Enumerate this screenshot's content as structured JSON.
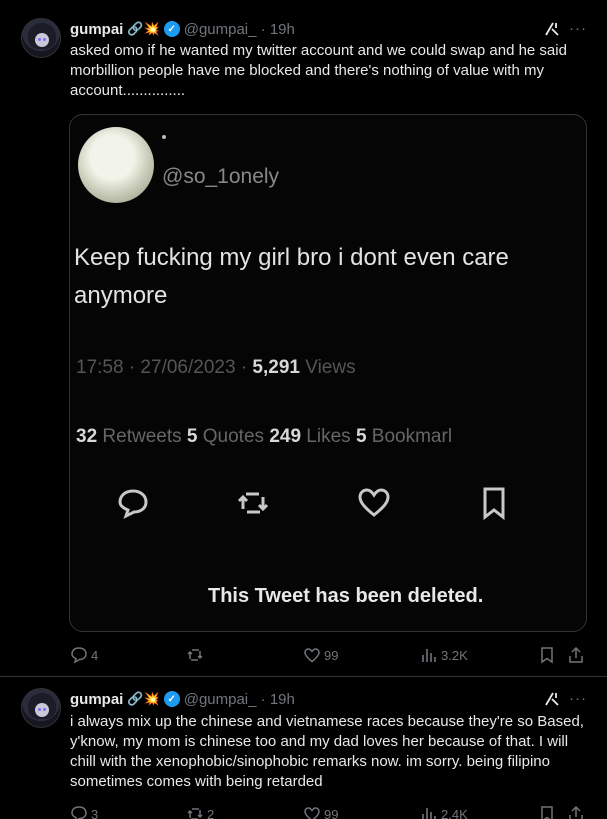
{
  "tweets": [
    {
      "name": "gumpai",
      "emoji": "🔗💥",
      "handle": "@gumpai_ · 19h",
      "text": "asked omo if he wanted my twitter account and we could swap and he said morbillion people have me blocked and there's nothing of value with my account...............",
      "embed": {
        "display_name": "•",
        "handle": "@so_1onely",
        "body": "Keep fucking my girl bro i dont even care anymore",
        "timestamp": "17:58 · 27/06/2023 · ",
        "views_count": "5,291",
        "views_label": " Views",
        "retweets_count": "32",
        "retweets_label": " Retweets ",
        "quotes_count": "5",
        "quotes_label": " Quotes ",
        "likes_count": "249",
        "likes_label": " Likes ",
        "bookmarks_count": "5",
        "bookmarks_label": " Bookmarl",
        "deleted_notice": "This Tweet has been deleted."
      },
      "stats": {
        "replies": "4",
        "reposts": "",
        "likes": "99",
        "views": "3.2K"
      }
    },
    {
      "name": "gumpai",
      "emoji": "🔗💥",
      "handle": "@gumpai_ · 19h",
      "text": "i always mix up the chinese and vietnamese races because they're so Based, y'know, my mom is chinese too and my dad loves her because of that. I will chill with the xenophobic/sinophobic remarks now. im sorry. being filipino sometimes comes with being retarded",
      "stats": {
        "replies": "3",
        "reposts": "2",
        "likes": "99",
        "views": "2.4K"
      }
    }
  ],
  "icons": {
    "verified": "verified-badge-icon",
    "grok": "grok-icon",
    "more": "more-icon",
    "reply": "reply-icon",
    "repost": "repost-icon",
    "like": "like-icon",
    "views": "views-icon",
    "bookmark": "bookmark-icon",
    "share": "share-icon"
  },
  "colors": {
    "accent": "#1d9bf0",
    "muted": "#71767b",
    "text": "#e7e9ea",
    "border": "#2f3336"
  }
}
